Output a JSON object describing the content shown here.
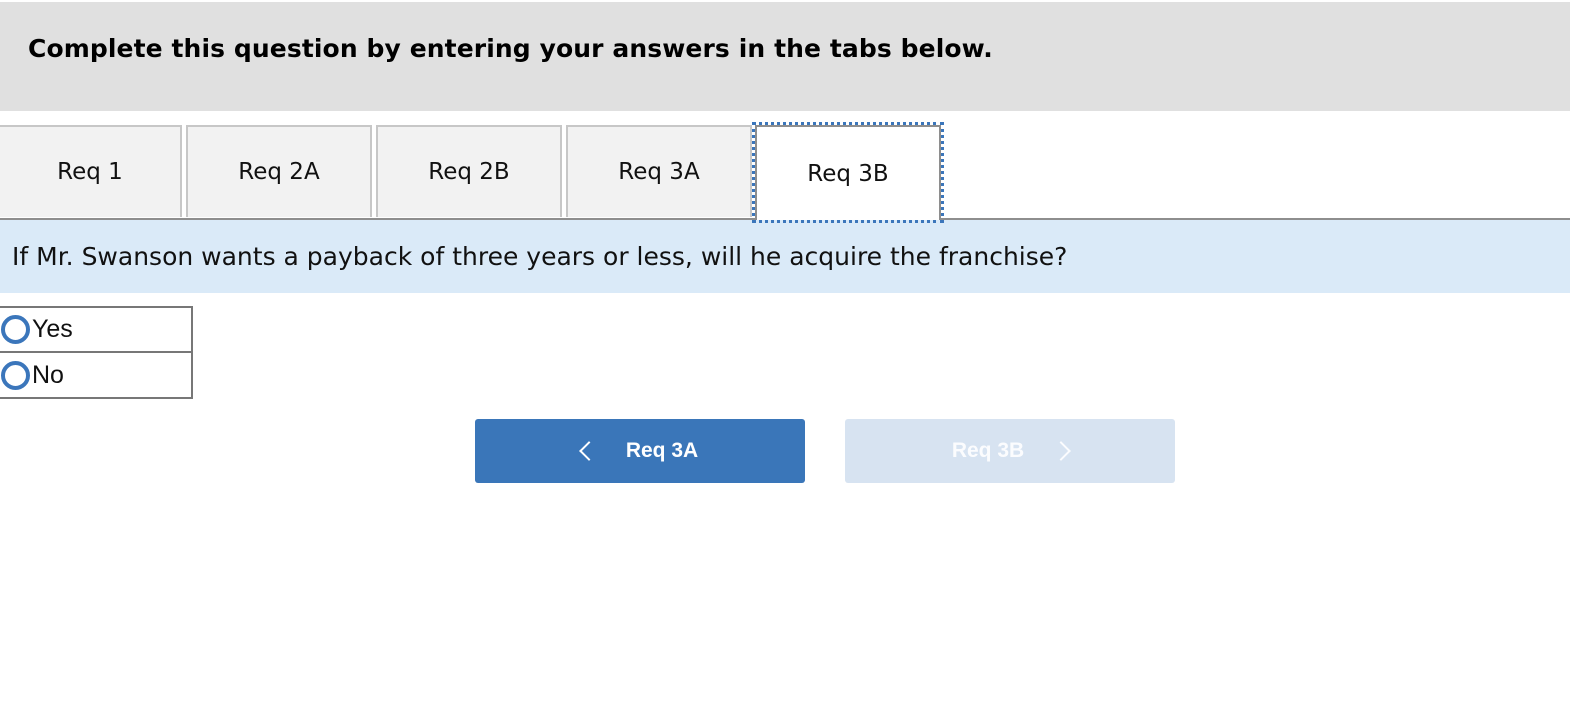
{
  "header": {
    "title": "Complete this question by entering your answers in the tabs below."
  },
  "tabs": [
    {
      "label": "Req 1",
      "active": false
    },
    {
      "label": "Req 2A",
      "active": false
    },
    {
      "label": "Req 2B",
      "active": false
    },
    {
      "label": "Req 3A",
      "active": false
    },
    {
      "label": "Req 3B",
      "active": true
    }
  ],
  "question": {
    "text": "If Mr. Swanson wants a payback of three years or less, will he acquire the franchise?"
  },
  "options": [
    {
      "label": "Yes",
      "selected": false,
      "icon": "radio-unchecked-icon"
    },
    {
      "label": "No",
      "selected": false,
      "icon": "radio-unchecked-icon"
    }
  ],
  "navigation": {
    "prev_label": "Req 3A",
    "prev_icon": "chevron-left-icon",
    "next_label": "Req 3B",
    "next_icon": "chevron-right-icon",
    "next_disabled": true
  },
  "colors": {
    "accent": "#3a76b9",
    "question_bg": "#daeaf8",
    "header_bg": "#e0e0e0",
    "disabled_button": "#d7e3f1"
  }
}
